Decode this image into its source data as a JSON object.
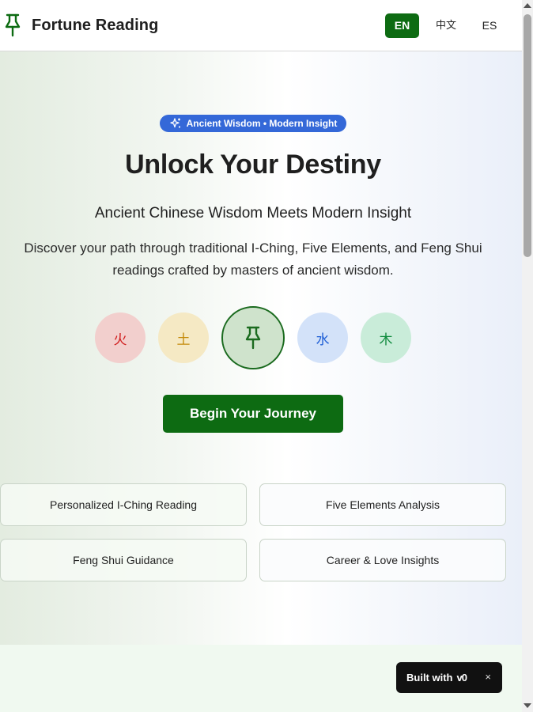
{
  "header": {
    "brand_name": "Fortune Reading",
    "brand_icon": "pin-icon",
    "languages": [
      "EN",
      "中文",
      "ES"
    ],
    "active_language": "EN"
  },
  "hero": {
    "badge": "Ancient Wisdom • Modern Insight",
    "badge_icon": "sparkles-icon",
    "title": "Unlock Your Destiny",
    "subtitle": "Ancient Chinese Wisdom Meets Modern Insight",
    "description": "Discover your path through traditional I-Ching, Five Elements, and Feng Shui readings crafted by masters of ancient wisdom.",
    "elements": [
      {
        "char": "火",
        "color": "#d11d1d",
        "bg": "#f2cfcd"
      },
      {
        "char": "土",
        "color": "#c48a0a",
        "bg": "#f5e9c4"
      },
      {
        "char": "",
        "icon": "pin-icon",
        "color": "#1b6b1f",
        "bg": "#cfe3cc"
      },
      {
        "char": "水",
        "color": "#1f5fd6",
        "bg": "#d3e2f9"
      },
      {
        "char": "木",
        "color": "#0f8a3d",
        "bg": "#c9ecd9"
      }
    ],
    "cta_label": "Begin Your Journey"
  },
  "features": [
    "Personalized I-Ching Reading",
    "Five Elements Analysis",
    "Feng Shui Guidance",
    "Career & Love Insights"
  ],
  "toast": {
    "label": "Built with",
    "logo": "v0",
    "close": "×"
  },
  "colors": {
    "primary": "#0d6b12",
    "badge": "#3468d8"
  }
}
